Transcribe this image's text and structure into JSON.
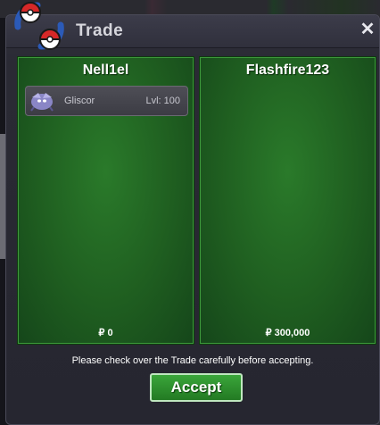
{
  "window": {
    "title": "Trade",
    "close_label": "✕"
  },
  "left_panel": {
    "player_name": "Nell1el",
    "pokemon": [
      {
        "name": "Gliscor",
        "level": "Lvl: 100"
      }
    ],
    "money": "₽ 0"
  },
  "right_panel": {
    "player_name": "Flashfire123",
    "pokemon": [],
    "money": "₽ 300,000"
  },
  "footer": {
    "notice": "Please check over the Trade carefully before accepting.",
    "accept_label": "Accept"
  },
  "colors": {
    "panel_green": "#1f5e20",
    "accept_green": "#2e8f2e",
    "window_bg": "#2a2a34"
  }
}
